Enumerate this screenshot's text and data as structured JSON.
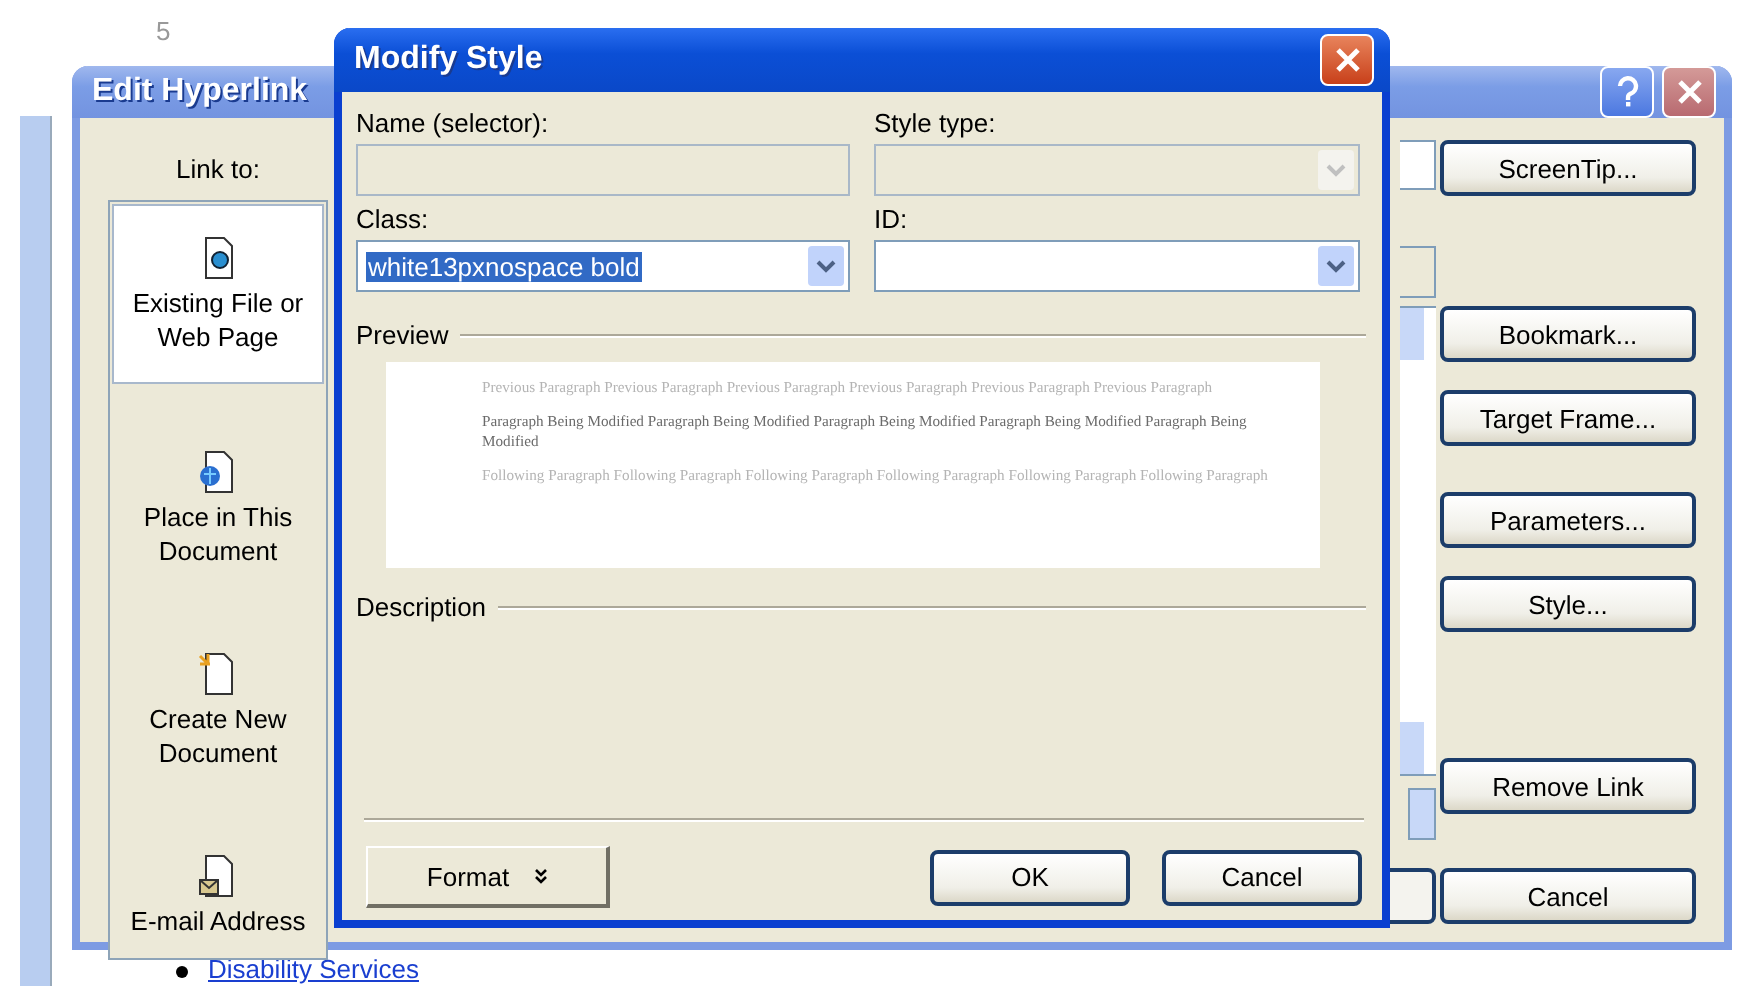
{
  "background": {
    "line_number": "5",
    "link": "Disability Services"
  },
  "edit_hyperlink": {
    "title": "Edit Hyperlink",
    "link_to_label": "Link to:",
    "link_targets": [
      {
        "label": "Existing File or Web Page",
        "selected": true
      },
      {
        "label": "Place in This Document",
        "selected": false
      },
      {
        "label": "Create New Document",
        "selected": false
      },
      {
        "label": "E-mail Address",
        "selected": false
      }
    ],
    "buttons": [
      {
        "label": "ScreenTip..."
      },
      {
        "label": "Bookmark..."
      },
      {
        "label": "Target Frame..."
      },
      {
        "label": "Parameters..."
      },
      {
        "label": "Style..."
      },
      {
        "label": "Remove Link"
      },
      {
        "label": "Cancel"
      }
    ]
  },
  "modify_style": {
    "title": "Modify Style",
    "fields": [
      {
        "label": "Name (selector):",
        "kind": "text",
        "disabled": true
      },
      {
        "label": "Style type:",
        "kind": "dropdown",
        "disabled": true
      },
      {
        "label": "Class:",
        "kind": "dropdown",
        "disabled": false,
        "value": "white13pxnospace bold",
        "selected": true
      },
      {
        "label": "ID:",
        "kind": "dropdown",
        "disabled": false
      }
    ],
    "preview_label": "Preview",
    "preview": [
      {
        "kind": "previous",
        "text": "Previous Paragraph Previous Paragraph Previous Paragraph Previous Paragraph Previous Paragraph Previous Paragraph"
      },
      {
        "kind": "modified",
        "text": "Paragraph Being Modified Paragraph Being Modified Paragraph Being Modified Paragraph Being Modified Paragraph Being Modified"
      },
      {
        "kind": "following",
        "text": "Following Paragraph Following Paragraph Following Paragraph Following Paragraph Following Paragraph Following Paragraph"
      }
    ],
    "description_label": "Description",
    "format_button": "Format",
    "buttons": [
      "OK",
      "Cancel"
    ]
  }
}
